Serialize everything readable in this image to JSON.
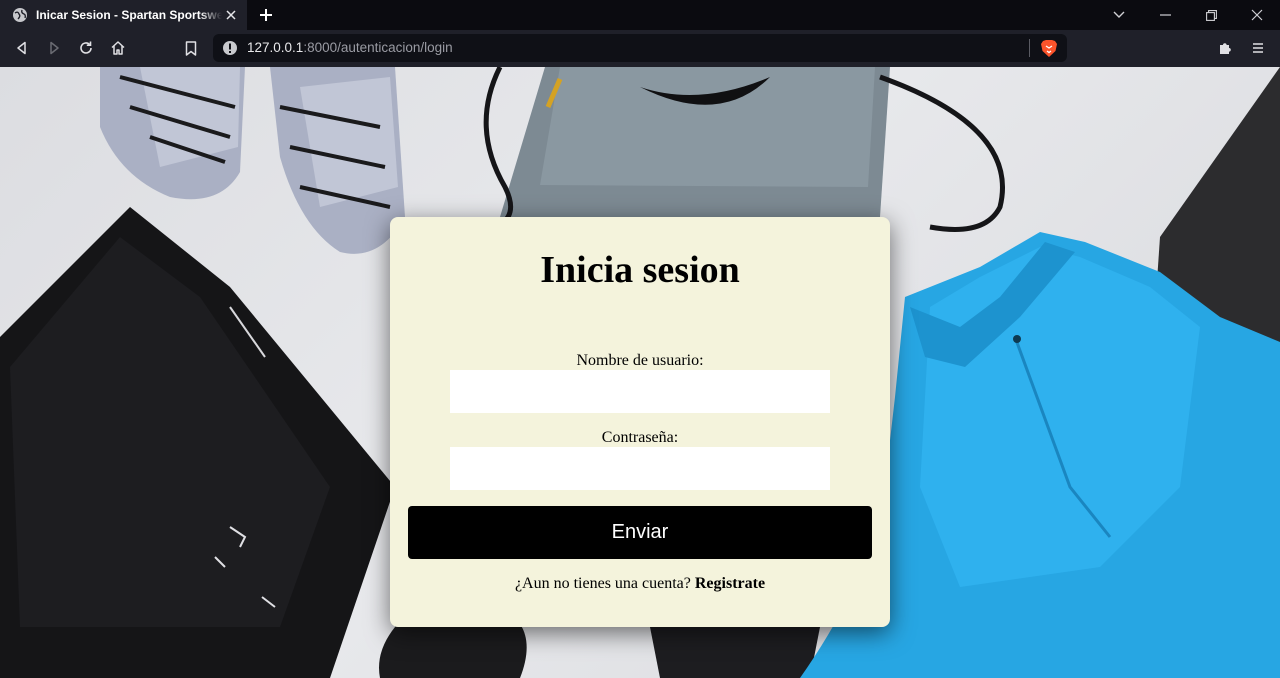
{
  "browser": {
    "tab_title": "Inicar Sesion - Spartan Sportswear",
    "url_host": "127.0.0.1",
    "url_rest": ":8000/autenticacion/login"
  },
  "icons": {
    "favicon": "globe-icon",
    "tab_close": "close-icon",
    "new_tab": "plus-icon",
    "back": "arrow-left-icon",
    "forward": "arrow-right-icon",
    "reload": "reload-icon",
    "home": "home-icon",
    "bookmark": "bookmark-icon",
    "site_info": "info-icon",
    "brave_shields": "brave-lion-icon",
    "extensions": "puzzle-icon",
    "menu": "hamburger-menu-icon"
  },
  "login": {
    "title": "Inicia sesion",
    "username_label": "Nombre de usuario:",
    "username_value": "",
    "password_label": "Contraseña:",
    "password_value": "",
    "submit_label": "Enviar",
    "register_prompt": "¿Aun no tienes una cuenta?",
    "register_link": "Registrate"
  },
  "colors": {
    "card_background": "#f4f3dc",
    "button_background": "#000000",
    "chrome_background": "#1f2029"
  }
}
